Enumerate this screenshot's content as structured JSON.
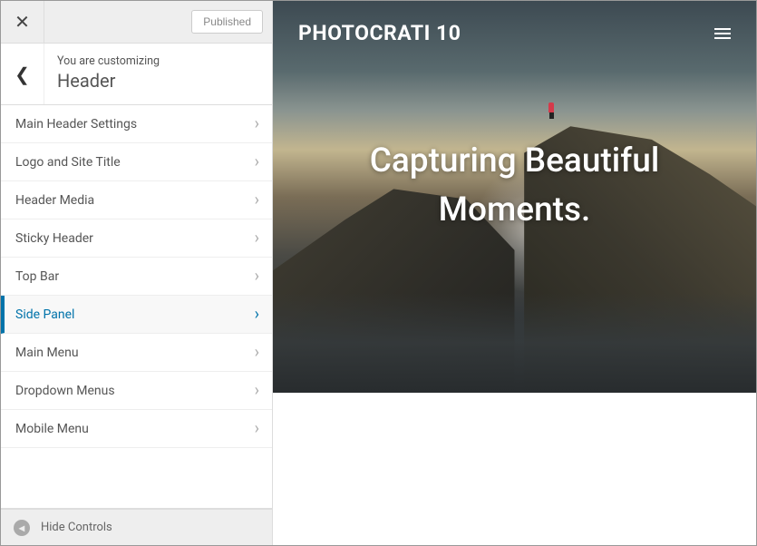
{
  "sidebar": {
    "publish_status": "Published",
    "subtext": "You are customizing",
    "title": "Header",
    "hide_controls": "Hide Controls"
  },
  "menu": [
    {
      "label": "Main Header Settings",
      "active": false
    },
    {
      "label": "Logo and Site Title",
      "active": false
    },
    {
      "label": "Header Media",
      "active": false
    },
    {
      "label": "Sticky Header",
      "active": false
    },
    {
      "label": "Top Bar",
      "active": false
    },
    {
      "label": "Side Panel",
      "active": true
    },
    {
      "label": "Main Menu",
      "active": false
    },
    {
      "label": "Dropdown Menus",
      "active": false
    },
    {
      "label": "Mobile Menu",
      "active": false
    }
  ],
  "preview": {
    "site_title": "PHOTOCRATI 10",
    "tagline_line1": "Capturing Beautiful",
    "tagline_line2": "Moments."
  }
}
